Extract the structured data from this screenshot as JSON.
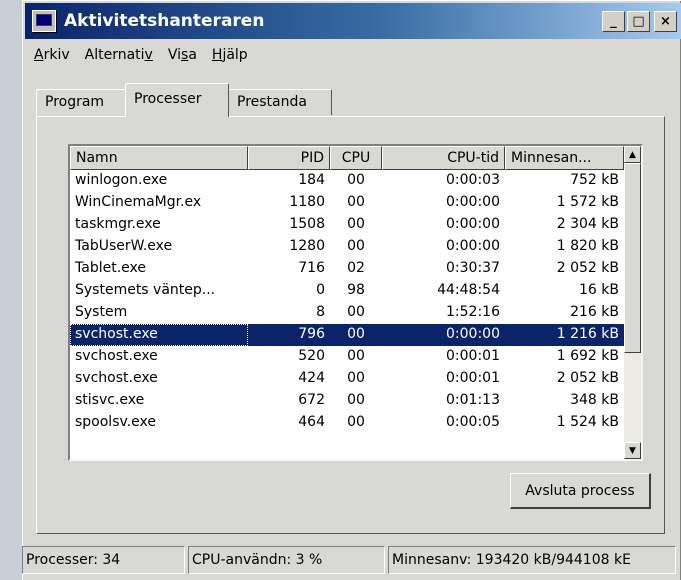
{
  "window": {
    "title": "Aktivitetshanteraren",
    "icon": "task-manager-icon",
    "controls": {
      "minimize": "_",
      "maximize": "□",
      "close": "×"
    }
  },
  "menu": [
    {
      "label": "Arkiv",
      "mnemonic": "A",
      "rest": "rkiv"
    },
    {
      "label": "Alternativ",
      "pre": "Alternati",
      "mnemonic": "v",
      "rest": ""
    },
    {
      "label": "Visa",
      "pre": "Vi",
      "mnemonic": "s",
      "rest": "a"
    },
    {
      "label": "Hjälp",
      "mnemonic": "H",
      "rest": "jälp"
    }
  ],
  "tabs": [
    "Program",
    "Processer",
    "Prestanda"
  ],
  "active_tab": "Processer",
  "columns": [
    "Namn",
    "PID",
    "CPU",
    "CPU-tid",
    "Minnesan..."
  ],
  "processes": [
    {
      "name": "winlogon.exe",
      "pid": "184",
      "cpu": "00",
      "time": "0:00:03",
      "mem": "752 kB"
    },
    {
      "name": "WinCinemaMgr.ex",
      "pid": "1180",
      "cpu": "00",
      "time": "0:00:00",
      "mem": "1 572 kB"
    },
    {
      "name": "taskmgr.exe",
      "pid": "1508",
      "cpu": "00",
      "time": "0:00:00",
      "mem": "2 304 kB"
    },
    {
      "name": "TabUserW.exe",
      "pid": "1280",
      "cpu": "00",
      "time": "0:00:00",
      "mem": "1 820 kB"
    },
    {
      "name": "Tablet.exe",
      "pid": "716",
      "cpu": "02",
      "time": "0:30:37",
      "mem": "2 052 kB"
    },
    {
      "name": "Systemets väntep...",
      "pid": "0",
      "cpu": "98",
      "time": "44:48:54",
      "mem": "16 kB"
    },
    {
      "name": "System",
      "pid": "8",
      "cpu": "00",
      "time": "1:52:16",
      "mem": "216 kB"
    },
    {
      "name": "svchost.exe",
      "pid": "796",
      "cpu": "00",
      "time": "0:00:00",
      "mem": "1 216 kB",
      "selected": true
    },
    {
      "name": "svchost.exe",
      "pid": "520",
      "cpu": "00",
      "time": "0:00:01",
      "mem": "1 692 kB"
    },
    {
      "name": "svchost.exe",
      "pid": "424",
      "cpu": "00",
      "time": "0:00:01",
      "mem": "2 052 kB"
    },
    {
      "name": "stisvc.exe",
      "pid": "672",
      "cpu": "00",
      "time": "0:01:13",
      "mem": "348 kB"
    },
    {
      "name": "spoolsv.exe",
      "pid": "464",
      "cpu": "00",
      "time": "0:00:05",
      "mem": "1 524 kB"
    }
  ],
  "end_process_button": "Avsluta process",
  "status": {
    "processes": "Processer: 34",
    "cpu": "CPU-användn: 3 %",
    "memory": "Minnesanv: 193420 kB/944108 kE"
  },
  "colors": {
    "title_gradient_start": "#0a246a",
    "title_gradient_end": "#a6caf0",
    "selection": "#0a246a",
    "face": "#d8d8d4"
  }
}
